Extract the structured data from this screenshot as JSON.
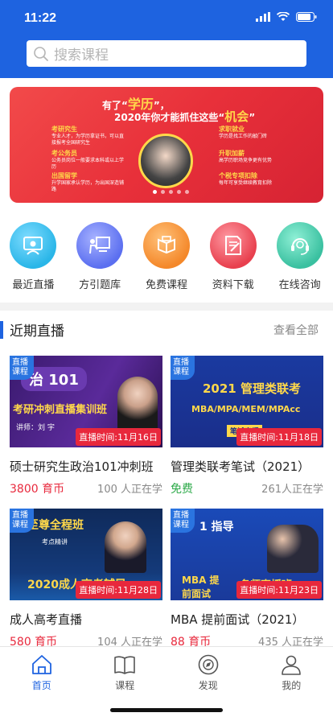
{
  "status_bar": {
    "time": "11:22"
  },
  "search": {
    "placeholder": "搜索课程"
  },
  "banner": {
    "line1_pre": "有了“",
    "line1_hl": "学历",
    "line1_post": "”，",
    "line2_pre": "2020年你才能抓住这些“",
    "line2_hl": "机会",
    "line2_post": "”",
    "items": [
      {
        "title": "考研究生",
        "desc": "专业人才，为学历拿证书，可以直接报考全国研究生"
      },
      {
        "title": "考公务员",
        "desc": "公务员岗位一般要求本科或以上学历"
      },
      {
        "title": "出国留学",
        "desc": "升学国家承认学历，为出国深造铺路"
      },
      {
        "title": "求职就业",
        "desc": "学历是找工作的敲门砖"
      },
      {
        "title": "升职加薪",
        "desc": "高学历职场竞争更有优势"
      },
      {
        "title": "个税专项扣除",
        "desc": "每年可享受继续教育扣除"
      }
    ]
  },
  "quicknav": [
    {
      "label": "最近直播",
      "icon": "live-icon",
      "color": "#2ab6e8"
    },
    {
      "label": "方引题库",
      "icon": "question-bank-icon",
      "color": "#5b6ff0"
    },
    {
      "label": "免费课程",
      "icon": "free-course-icon",
      "color": "#f4882a"
    },
    {
      "label": "资料下载",
      "icon": "download-icon",
      "color": "#e8404e"
    },
    {
      "label": "在线咨询",
      "icon": "consult-icon",
      "color": "#3ac0a0"
    }
  ],
  "section": {
    "title": "近期直播",
    "more": "查看全部"
  },
  "courses": [
    {
      "tag": "直播课程",
      "thumb_line1": "治 101",
      "thumb_line2": "考研冲刺直播集训班",
      "thumb_line3": "讲师：刘 宇",
      "time": "直播时间:11月16日",
      "title": "硕士研究生政治101冲刺班",
      "price": "3800 育币",
      "viewers": "100 人正在学"
    },
    {
      "tag": "直播课程",
      "thumb_line1": "2021 管理类联考",
      "thumb_line2": "MBA/MPA/MEM/MPAcc",
      "thumb_line3": "笔试直播",
      "time": "直播时间:11月18日",
      "title": "管理类联考笔试（2021）",
      "price": "免费",
      "viewers": "261人正在学"
    },
    {
      "tag": "直播课程",
      "thumb_line1": "至尊全程班",
      "thumb_line2": "考点精讲",
      "thumb_line3": "2020成人高考辅导",
      "time": "直播时间:11月28日",
      "title": "成人高考直播",
      "price": "580 育币",
      "viewers": "104 人正在学"
    },
    {
      "tag": "直播课程",
      "thumb_line1": "1 指导",
      "thumb_line2": "MBA 提前面试",
      "thumb_line3": "名师直播班",
      "time": "直播时间:11月23日",
      "title": "MBA 提前面试（2021）",
      "price": "88 育币",
      "viewers": "435 人正在学"
    }
  ],
  "tabbar": [
    {
      "label": "首页",
      "icon": "home-icon",
      "active": true
    },
    {
      "label": "课程",
      "icon": "book-icon",
      "active": false
    },
    {
      "label": "发现",
      "icon": "discover-icon",
      "active": false
    },
    {
      "label": "我的",
      "icon": "profile-icon",
      "active": false
    }
  ]
}
